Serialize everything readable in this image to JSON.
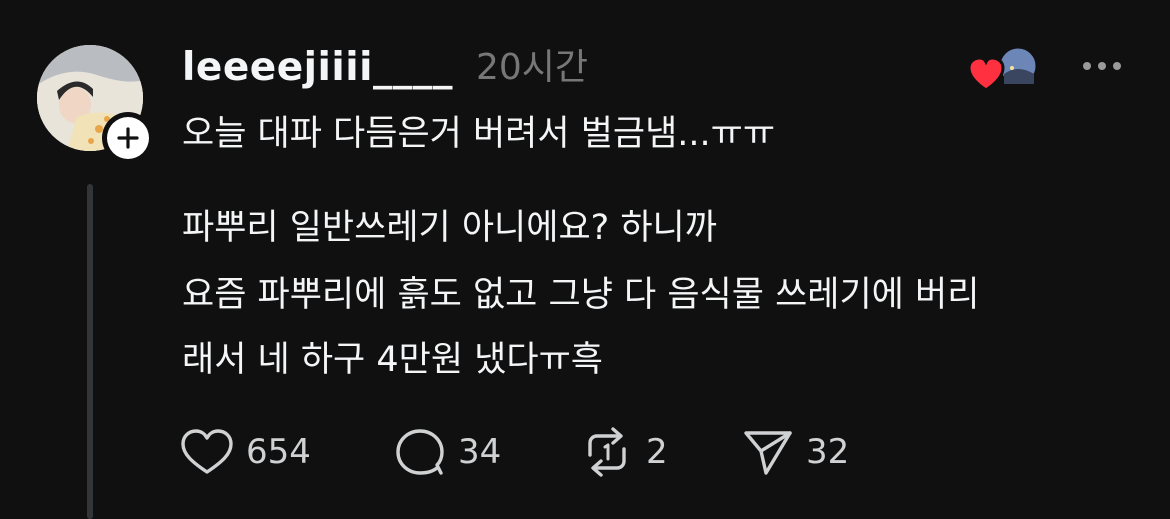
{
  "post": {
    "username": "leeeejiiii____",
    "timestamp": "20시간",
    "lines": [
      "오늘 대파 다듬은거 버려서 벌금냄...ㅠㅠ",
      "파뿌리 일반쓰레기 아니에요? 하니까",
      "요즘 파뿌리에 흙도 없고 그냥 다 음식물 쓰레기에 버리",
      "래서 네 하구 4만원 냈다ㅠ흑"
    ]
  },
  "actions": {
    "like_count": "654",
    "comment_count": "34",
    "repost_count": "2",
    "share_count": "32"
  },
  "icons": {
    "follow": "plus-icon",
    "liked_by": "heart-badge-icon",
    "more": "more-horizontal-icon",
    "like": "heart-icon",
    "comment": "comment-bubble-icon",
    "repost": "repost-icon",
    "share": "paper-plane-icon"
  },
  "colors": {
    "background": "#101010",
    "text": "#f3f5f7",
    "secondary_text": "#777777",
    "liked_heart": "#ff3040"
  }
}
